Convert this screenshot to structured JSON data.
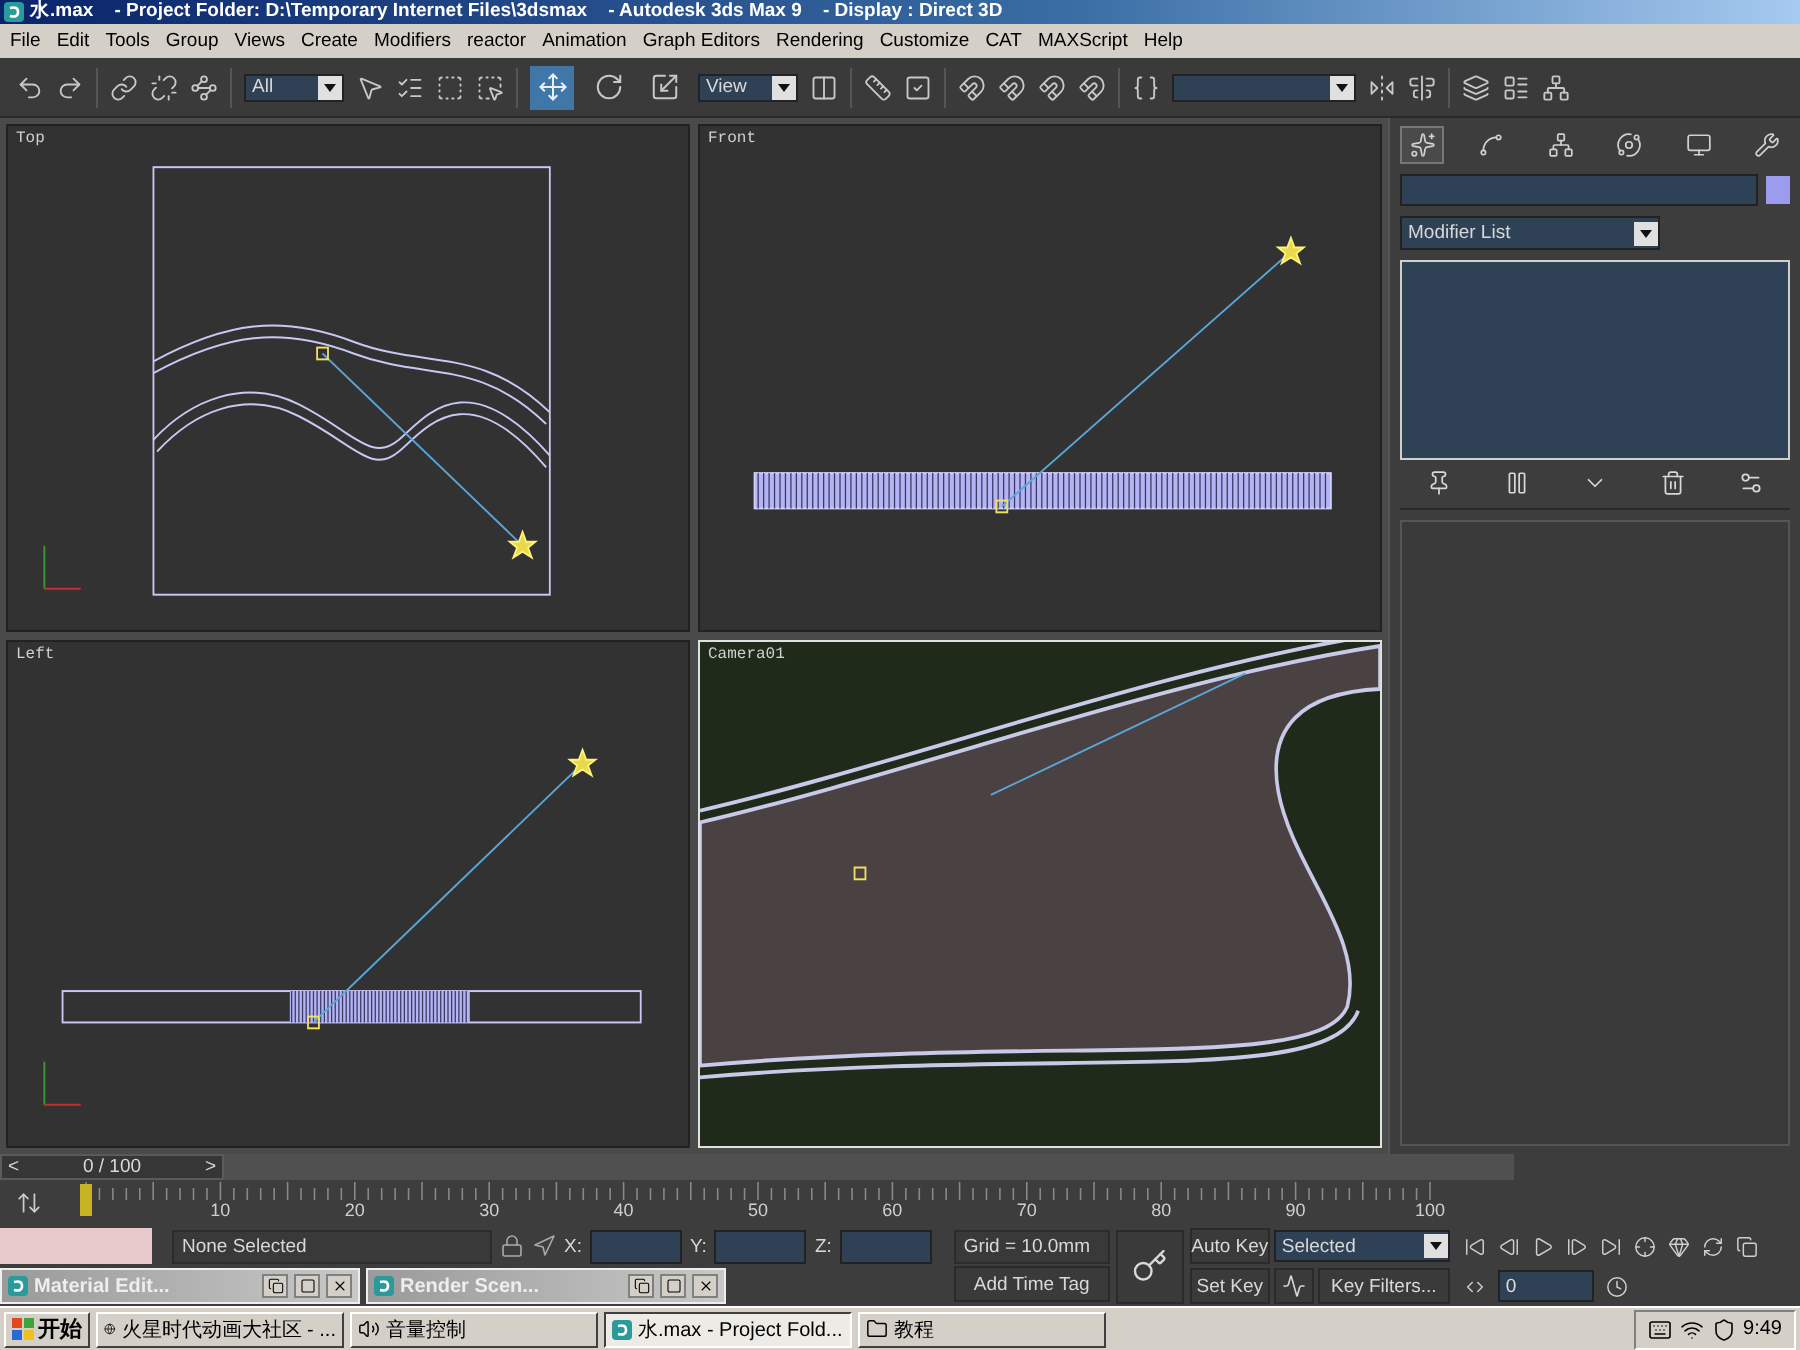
{
  "window": {
    "title": "水.max    - Project Folder: D:\\Temporary Internet Files\\3dsmax    - Autodesk 3ds Max 9    - Display : Direct 3D"
  },
  "menu": [
    "File",
    "Edit",
    "Tools",
    "Group",
    "Views",
    "Create",
    "Modifiers",
    "reactor",
    "Animation",
    "Graph Editors",
    "Rendering",
    "Customize",
    "CAT",
    "MAXScript",
    "Help"
  ],
  "toolbar": {
    "selection_filter": "All",
    "reference_coord": "View",
    "transform_tools": [
      {
        "kind": "move",
        "selected": true
      },
      {
        "kind": "rotate",
        "selected": false
      },
      {
        "kind": "scale",
        "selected": false
      }
    ]
  },
  "viewports": [
    {
      "label": "Top",
      "kind": "top",
      "active": false
    },
    {
      "label": "Front",
      "kind": "front",
      "active": false
    },
    {
      "label": "Left",
      "kind": "left",
      "active": false
    },
    {
      "label": "Camera01",
      "kind": "camera",
      "active": true
    }
  ],
  "command_panel": {
    "modifier_list": "Modifier List"
  },
  "time_slider": {
    "position": "0 / 100",
    "prev": "<",
    "next": ">",
    "level": 0
  },
  "track_bar": {
    "ticks": [
      "10",
      "20",
      "30",
      "40",
      "50",
      "60",
      "70",
      "80",
      "90",
      "100"
    ]
  },
  "status": {
    "selection": "None Selected",
    "x_label": "X:",
    "y_label": "Y:",
    "z_label": "Z:",
    "grid": "Grid = 10.0mm",
    "time_tag": "Add Time Tag",
    "auto_key": "Auto Key",
    "key_mode": "Selected",
    "set_key": "Set Key",
    "key_filters": "Key Filters...",
    "frame": "0"
  },
  "minimized_windows": [
    "Material Edit...",
    "Render Scen..."
  ],
  "taskbar": {
    "start": "开始",
    "tasks": [
      {
        "label": "火星时代动画大社区 - ...",
        "kind": "browser",
        "selected": false
      },
      {
        "label": "音量控制",
        "kind": "volume",
        "selected": false
      },
      {
        "label": "水.max     - Project Fold...",
        "kind": "max",
        "selected": true
      },
      {
        "label": "教程",
        "kind": "folder",
        "selected": false
      }
    ],
    "clock": "9:49"
  }
}
